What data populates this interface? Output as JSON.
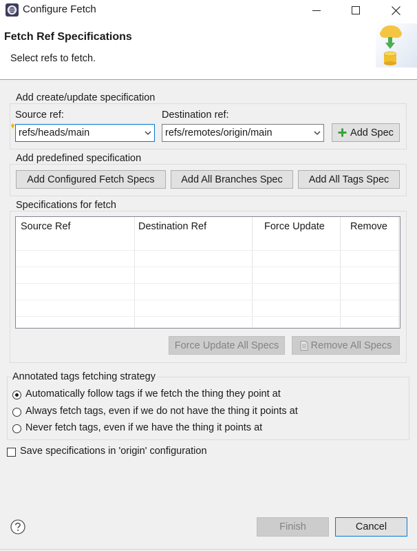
{
  "window": {
    "title": "Configure Fetch",
    "controls": {
      "minimize": "—",
      "maximize": "☐",
      "close": "✕"
    }
  },
  "banner": {
    "title": "Fetch Ref Specifications",
    "subtitle": "Select refs to fetch."
  },
  "create_group": {
    "legend": "Add create/update specification",
    "source_label": "Source ref:",
    "source_value": "refs/heads/main",
    "dest_label": "Destination ref:",
    "dest_value": "refs/remotes/origin/main",
    "add_spec_label": "Add Spec"
  },
  "predefined_group": {
    "legend": "Add predefined specification",
    "buttons": [
      "Add Configured Fetch Specs",
      "Add All Branches Spec",
      "Add All Tags Spec"
    ]
  },
  "specs_group": {
    "legend": "Specifications for fetch",
    "columns": [
      "Source Ref",
      "Destination Ref",
      "Force Update",
      "Remove"
    ],
    "rows": [],
    "force_update_all_label": "Force Update All Specs",
    "remove_all_label": "Remove All Specs"
  },
  "tags_group": {
    "legend": "Annotated tags fetching strategy",
    "options": [
      {
        "label": "Automatically follow tags if we fetch the thing they point at",
        "selected": true
      },
      {
        "label": "Always fetch tags, even if we do not have the thing it points at",
        "selected": false
      },
      {
        "label": "Never fetch tags, even if we have the thing it points at",
        "selected": false
      }
    ]
  },
  "save_config": {
    "label": "Save specifications in 'origin' configuration",
    "checked": false
  },
  "footer": {
    "help_icon": "help-icon",
    "finish_label": "Finish",
    "cancel_label": "Cancel"
  },
  "colors": {
    "accent": "#0078d7",
    "disabled_text": "#838383",
    "add_icon_green": "#3aa33a"
  }
}
